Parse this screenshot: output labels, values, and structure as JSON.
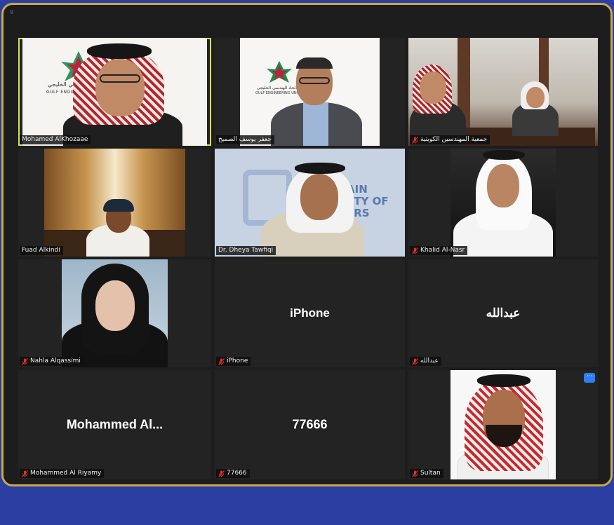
{
  "corner_label": "9",
  "participants": [
    {
      "name": "Mohamed AlKhozaae",
      "muted": false,
      "active": true,
      "has_video": true
    },
    {
      "name": "جعفر يوسف الصميخ",
      "muted": false,
      "active": false,
      "has_video": true
    },
    {
      "name": "جمعية المهندسين الكويتية",
      "muted": true,
      "active": false,
      "has_video": true
    },
    {
      "name": "Fuad Alkindi",
      "muted": false,
      "active": false,
      "has_video": true
    },
    {
      "name": "Dr. Dheya Tawfiqi",
      "muted": false,
      "active": false,
      "has_video": true
    },
    {
      "name": "Khalid Al-Nasr",
      "muted": true,
      "active": false,
      "has_video": true
    },
    {
      "name": "Nahla Alqassimi",
      "muted": true,
      "active": false,
      "has_video": true
    },
    {
      "name": "iPhone",
      "muted": true,
      "active": false,
      "has_video": false,
      "display_name": "iPhone"
    },
    {
      "name": "عبدالله",
      "muted": true,
      "active": false,
      "has_video": false,
      "display_name": "عبدالله"
    },
    {
      "name": "Mohammed Al Riyamy",
      "muted": true,
      "active": false,
      "has_video": false,
      "display_name": "Mohammed  Al..."
    },
    {
      "name": "77666",
      "muted": true,
      "active": false,
      "has_video": false,
      "display_name": "77666"
    },
    {
      "name": "Sultan",
      "muted": true,
      "active": false,
      "has_video": true
    }
  ],
  "logos": {
    "gulf_engineering_ar": "الهندسي الخليجي",
    "gulf_engineering_en": "GULF ENGINEERING",
    "gulf_engineering_ar_2": "الاتحاد الهندسي الخليجي",
    "gulf_engineering_en_2": "GULF ENGINEERING UNION",
    "bahrain_society_line1": "AIN",
    "bahrain_society_line2": "ETY OF",
    "bahrain_society_line3": "ERS"
  },
  "more_button_label": "···",
  "colors": {
    "background": "#2a3fa1",
    "frame_border": "#c9a84c",
    "active_speaker": "#d4e34a",
    "muted_icon": "#e02f2f",
    "more_button": "#2d7ff9"
  }
}
